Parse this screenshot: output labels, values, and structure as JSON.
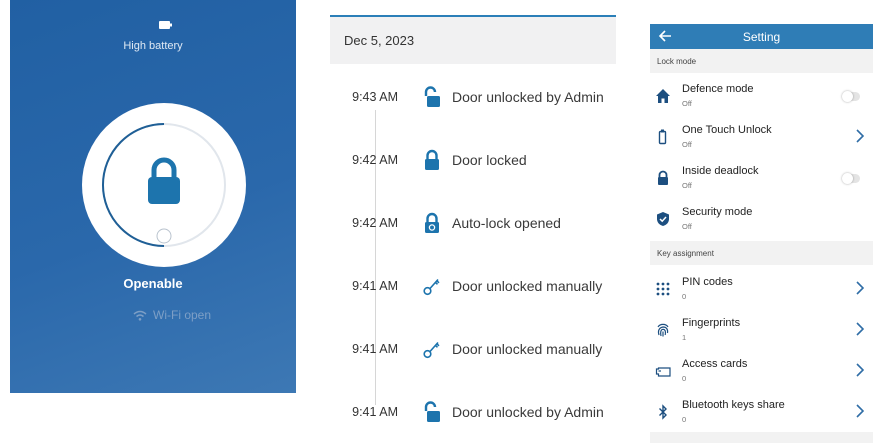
{
  "colors": {
    "brand_blue": "#2160a3",
    "accent_blue": "#2f7db6",
    "icon_blue": "#1d74ad"
  },
  "lock_panel": {
    "battery_icon": "battery-icon",
    "battery_text": "High battery",
    "lock_icon": "padlock-closed-icon",
    "state_text": "Openable",
    "wifi_icon": "wifi-icon",
    "wifi_text": "Wi-Fi open"
  },
  "history": {
    "date": "Dec 5, 2023",
    "events": [
      {
        "time": "9:43 AM",
        "icon": "padlock-open-icon",
        "text": "Door unlocked by Admin"
      },
      {
        "time": "9:42 AM",
        "icon": "padlock-closed-icon",
        "text": "Door locked"
      },
      {
        "time": "9:42 AM",
        "icon": "padlock-auto-icon",
        "text": "Auto-lock opened"
      },
      {
        "time": "9:41 AM",
        "icon": "key-icon",
        "text": "Door unlocked manually"
      },
      {
        "time": "9:41 AM",
        "icon": "key-icon",
        "text": "Door unlocked manually"
      },
      {
        "time": "9:41 AM",
        "icon": "padlock-open-icon",
        "text": "Door unlocked by Admin"
      }
    ]
  },
  "settings": {
    "title": "Setting",
    "back_icon": "back-arrow-icon",
    "sections": [
      {
        "label": "Lock mode",
        "items": [
          {
            "label": "Defence mode",
            "value": "Off",
            "icon": "home-icon",
            "control": "toggle"
          },
          {
            "label": "One Touch Unlock",
            "value": "Off",
            "icon": "phone-touch-icon",
            "control": "chevron"
          },
          {
            "label": "Inside deadlock",
            "value": "Off",
            "icon": "padlock-closed-icon",
            "control": "toggle"
          },
          {
            "label": "Security mode",
            "value": "Off",
            "icon": "shield-check-icon",
            "control": "none"
          }
        ]
      },
      {
        "label": "Key assignment",
        "items": [
          {
            "label": "PIN codes",
            "value": "0",
            "icon": "keypad-icon",
            "control": "chevron"
          },
          {
            "label": "Fingerprints",
            "value": "1",
            "icon": "fingerprint-icon",
            "control": "chevron"
          },
          {
            "label": "Access cards",
            "value": "0",
            "icon": "access-card-icon",
            "control": "chevron"
          },
          {
            "label": "Bluetooth keys share",
            "value": "0",
            "icon": "bluetooth-icon",
            "control": "chevron"
          }
        ]
      }
    ]
  }
}
